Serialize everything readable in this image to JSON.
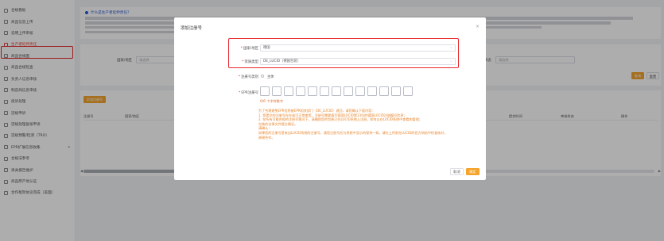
{
  "sidebar": {
    "items": [
      {
        "label": "合规看板"
      },
      {
        "label": "商品信息上传"
      },
      {
        "label": "说明上传审核"
      },
      {
        "label": "生产者延伸责任"
      },
      {
        "label": "商品合规面"
      },
      {
        "label": "商品合规检查"
      },
      {
        "label": "负责人信息审核"
      },
      {
        "label": "制造商信息审核"
      },
      {
        "label": "投诉处理"
      },
      {
        "label": "违规申诉"
      },
      {
        "label": "违规处理复核申诉"
      },
      {
        "label": "违规预警/检测（TRO）"
      },
      {
        "label": "EPR扩展信息收集"
      },
      {
        "label": "合规法参考"
      },
      {
        "label": "清关报告维护"
      },
      {
        "label": "商品原产地认证"
      },
      {
        "label": "合作框架协议完成（美国）"
      }
    ]
  },
  "background": {
    "notice_title": "什么是生产者延伸责任？",
    "filter_label_region": "国家/地区",
    "filter_placeholder_region": "请选择",
    "filter_label_status": "状态",
    "filter_placeholder_status": "请选择",
    "search_button": "查询",
    "reset_button": "重置",
    "add_button": "添加注册号",
    "columns": [
      "注册号",
      "国家/地区",
      "提交时间",
      "审核状态",
      "操作"
    ]
  },
  "dialog": {
    "title": "添加注册号",
    "close": "×",
    "region_label": "国家/地区",
    "region_value": "德国",
    "type_label": "资质类型",
    "type_value": "DE_LUCID（德国包装）",
    "entity_label": "注册号类别",
    "entity_option": "主体",
    "epr_label": "EPR注册号",
    "counter": "0/6 个字符数字",
    "tips": [
      "为了合理避免EPR信息被EPR相关部门（DE_LUCID）退回，请您确认下面内容：",
      "1. 您提交的注册号存在或可正常使用，注册号需要填写德国LUCID第13位的德国LUCID注册编号信息；",
      "2. 在所有可能合规的注册号情况下，请确保您的包装已在LUCID系统上注册，如何以在LUCID系统中查看和管理；",
      "包装的法律文件提交情况。",
      "请确认：",
      "如果您的注册号是来自LUCID系统的注册号，请您注册号应与系统中显示的保持一致，请在上传前在LUCID的官方网站中检查核对，",
      "谢谢合作。"
    ],
    "cancel_button": "取消",
    "ok_button": "确定"
  },
  "colors": {
    "accent": "#f5a42c",
    "highlight": "#e8262b",
    "tip": "#e8842a"
  }
}
